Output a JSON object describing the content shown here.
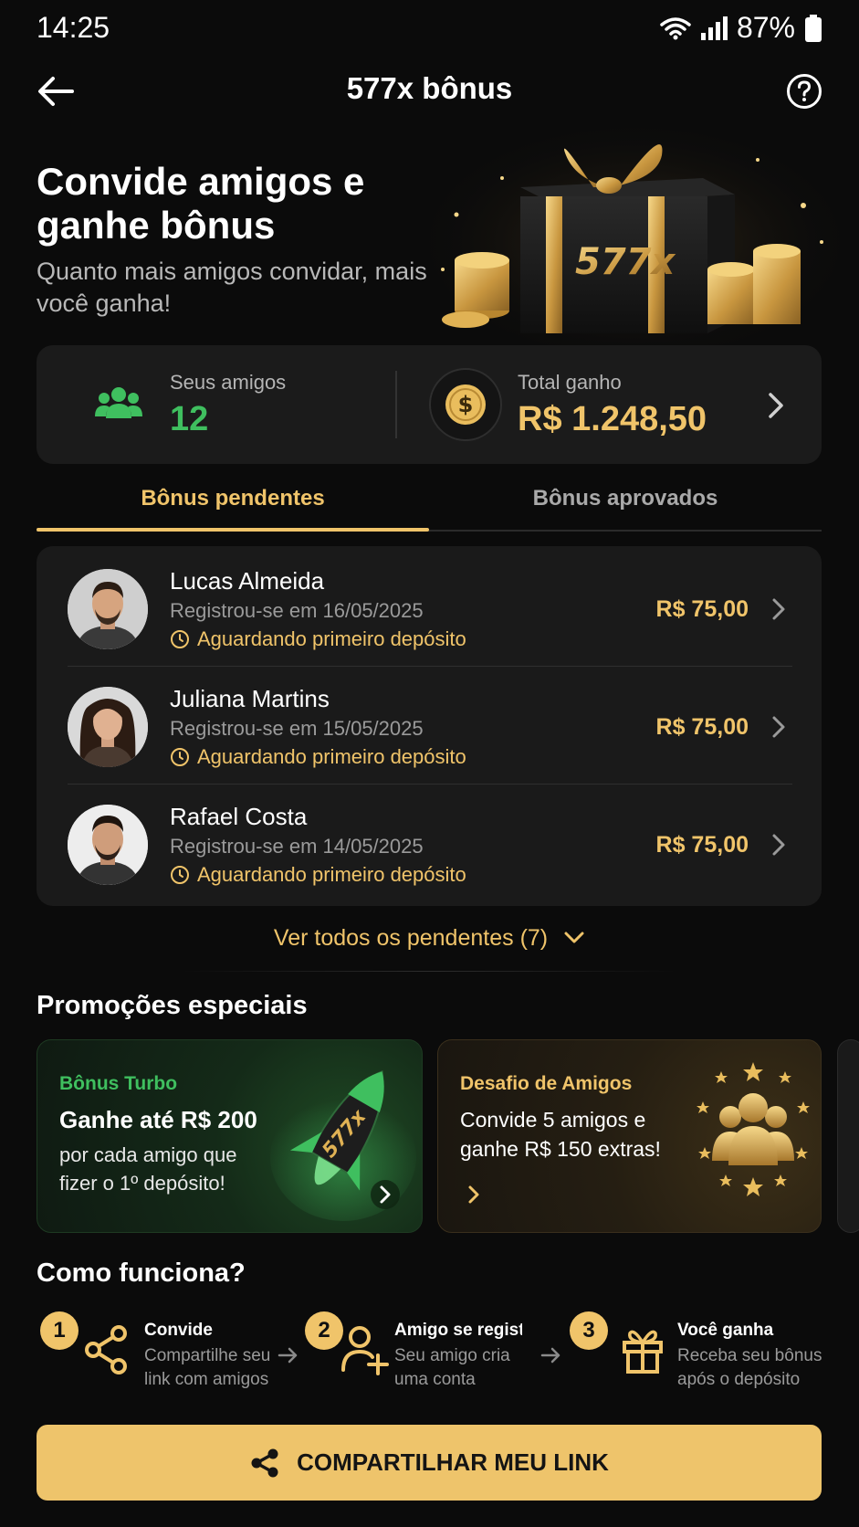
{
  "status_bar": {
    "time": "14:25",
    "battery": "87%"
  },
  "header": {
    "title": "577x bônus"
  },
  "hero": {
    "title": "Convide amigos e ganhe bônus",
    "subtitle": "Quanto mais amigos convidar, mais você ganha!",
    "box_brand": "577x"
  },
  "stats": {
    "friends_label": "Seus amigos",
    "friends_count": "12",
    "total_label": "Total ganho",
    "total_value": "R$ 1.248,50",
    "coin_symbol": "$"
  },
  "tabs": {
    "pending": "Bônus pendentes",
    "approved": "Bônus aprovados",
    "active": "pending"
  },
  "pending_list": [
    {
      "name": "Lucas Almeida",
      "date": "Registrou-se em 16/05/2025",
      "status": "Aguardando primeiro depósito",
      "amount": "R$ 75,00"
    },
    {
      "name": "Juliana Martins",
      "date": "Registrou-se em 15/05/2025",
      "status": "Aguardando primeiro depósito",
      "amount": "R$ 75,00"
    },
    {
      "name": "Rafael Costa",
      "date": "Registrou-se em 14/05/2025",
      "status": "Aguardando primeiro depósito",
      "amount": "R$ 75,00"
    }
  ],
  "see_all": "Ver todos os pendentes (7)",
  "promos": {
    "title": "Promoções especiais",
    "cards": [
      {
        "tag": "Bônus Turbo",
        "headline": "Ganhe até R$ 200",
        "body_line1": "por cada amigo que",
        "body_line2": "fizer o 1º depósito!",
        "rocket_text": "577x"
      },
      {
        "tag": "Desafio de Amigos",
        "headline": "",
        "body_line1": "Convide 5 amigos e",
        "body_line2": "ganhe R$ 150 extras!"
      }
    ]
  },
  "how": {
    "title": "Como funciona?",
    "steps": [
      {
        "num": "1",
        "title": "Convide",
        "desc1": "Compartilhe seu",
        "desc2": "link com amigos",
        "icon": "share-icon"
      },
      {
        "num": "2",
        "title": "Amigo se registra",
        "desc1": "Seu amigo cria",
        "desc2": "uma conta",
        "icon": "add-user-icon"
      },
      {
        "num": "3",
        "title": "Você ganha",
        "desc1": "Receba seu bônus",
        "desc2": "após o depósito",
        "icon": "gift-icon"
      }
    ]
  },
  "cta": {
    "label": "COMPARTILHAR MEU LINK"
  },
  "colors": {
    "accent": "#f0c46a",
    "green": "#3fbf5f",
    "background": "#0b0b0b",
    "card": "#1a1a1a"
  }
}
